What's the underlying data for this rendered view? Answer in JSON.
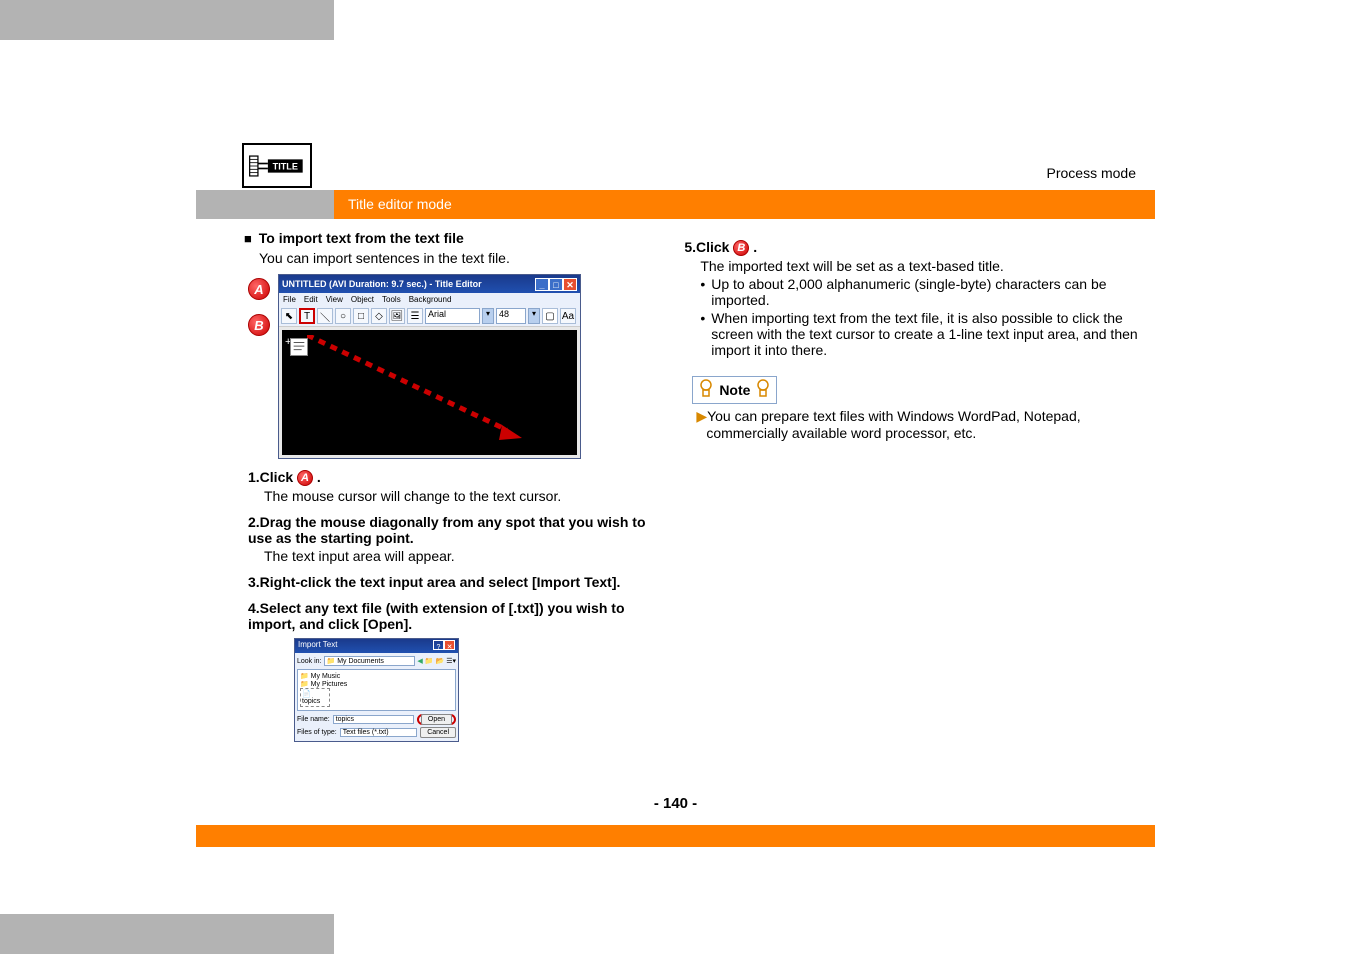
{
  "header": {
    "process_mode": "Process mode",
    "mode_title": "Title editor mode"
  },
  "left": {
    "heading": "To import text from the text file",
    "intro": "You can import sentences in the text file.",
    "steps": [
      {
        "label": "1.Click",
        "body": "The mouse cursor will change to the text cursor."
      },
      {
        "label": "2.Drag the mouse diagonally from any spot that you wish to use as the starting point.",
        "body": "The text input area will appear."
      },
      {
        "label": "3.Right-click the text input area and select [Import Text]."
      },
      {
        "label": "4.Select any text file (with extension of [.txt]) you wish to import, and click [Open]."
      }
    ]
  },
  "editor": {
    "title": "UNTITLED (AVI Duration: 9.7 sec.) - Title Editor",
    "menu": [
      "File",
      "Edit",
      "View",
      "Object",
      "Tools",
      "Background"
    ],
    "font": "Arial",
    "font_size": "48"
  },
  "dialog": {
    "title": "Import Text",
    "lookin_label": "Look in:",
    "lookin": "📁 My Documents",
    "folders": [
      "My Music",
      "My Pictures"
    ],
    "selected": "topics",
    "filename_label": "File name:",
    "filename": "topics",
    "filetype_label": "Files of type:",
    "filetype": "Text files (*.txt)",
    "open": "Open",
    "cancel": "Cancel"
  },
  "right": {
    "step5": {
      "label": "5.Click",
      "body": "The imported text will be set as a text-based title.",
      "bullets": [
        "Up to about 2,000 alphanumeric (single-byte) characters can be imported.",
        "When importing text from the text file, it is also possible to click the screen with the text cursor to create a 1-line text input area, and then import it into there."
      ]
    },
    "note": {
      "label": "Note",
      "body": "You can prepare text files with Windows WordPad, Notepad, commercially available word processor, etc."
    }
  },
  "footer": {
    "page": "- 140 -"
  }
}
